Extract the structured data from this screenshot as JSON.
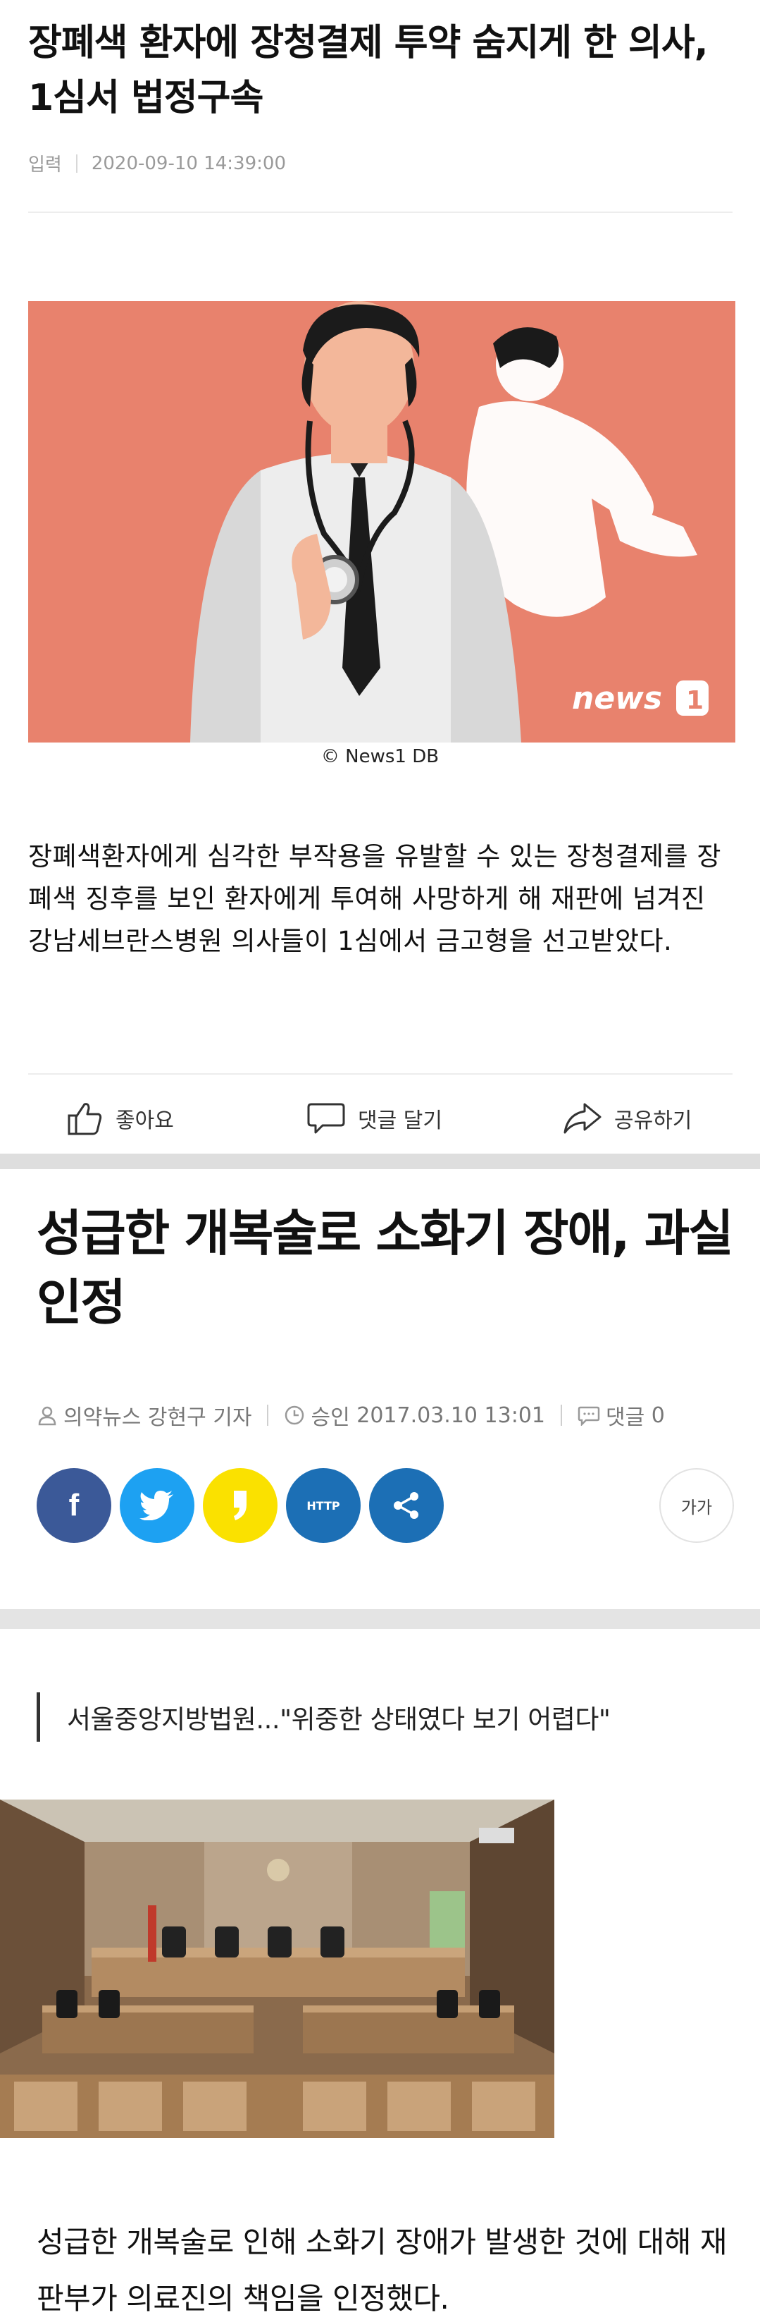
{
  "article1": {
    "title": "장폐색 환자에 장청결제 투약 숨지게 한 의사, 1심서 법정구속",
    "meta_label": "입력",
    "meta_date": "2020-09-10 14:39:00",
    "image_logo": "news",
    "image_credit": "© News1 DB",
    "body": "장폐색환자에게 심각한 부작용을 유발할 수 있는 장청결제를 장폐색 징후를 보인 환자에게 투여해 사망하게 해 재판에 넘겨진 강남세브란스병원 의사들이 1심에서 금고형을 선고받았다.",
    "actions": {
      "like": "좋아요",
      "comment": "댓글 달기",
      "share": "공유하기"
    },
    "colors": {
      "image_bg": "#e8826d"
    }
  },
  "article2": {
    "title": "성급한 개복술로 소화기 장애, 과실 인정",
    "author": "의약뉴스 강현구 기자",
    "approved_label": "승인",
    "approved_date": "2017.03.10 13:01",
    "comments_label": "댓글",
    "comments_count": "0",
    "share_buttons": {
      "facebook": "f",
      "http": "HTTP"
    },
    "font_size_button": "가가",
    "quote": "서울중앙지방법원...\"위중한 상태였다 보기 어렵다\"",
    "body": "성급한 개복술로 인해 소화기 장애가 발생한 것에 대해 재판부가 의료진의 책임을 인정했다.",
    "colors": {
      "facebook": "#3b5998",
      "twitter": "#1da1f2",
      "kakao": "#fae100",
      "http": "#1c6fb5",
      "share": "#1c6fb5"
    }
  }
}
